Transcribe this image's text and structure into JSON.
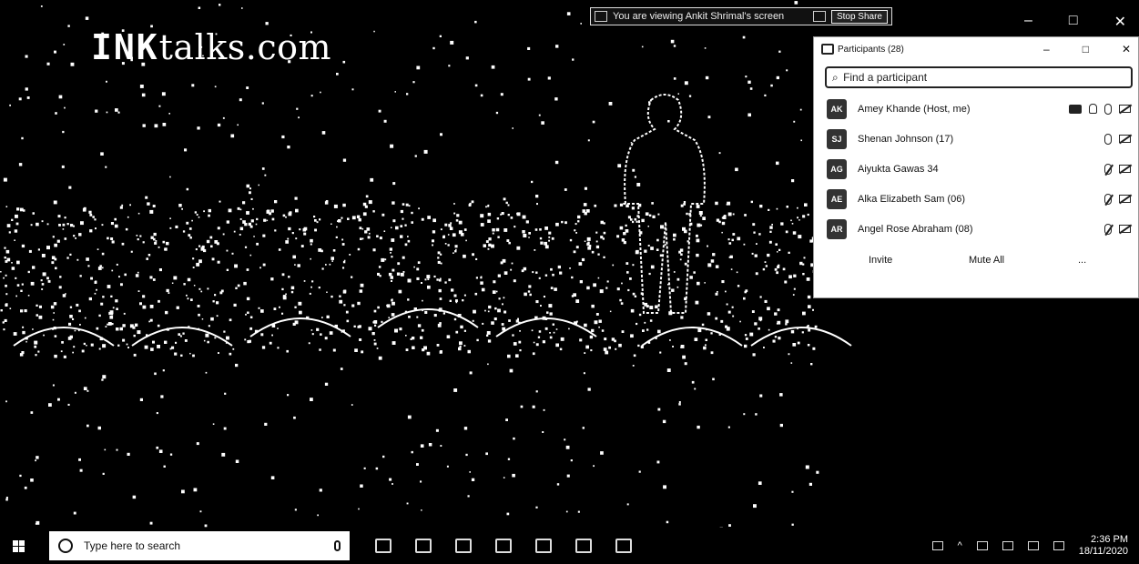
{
  "brand": {
    "prefix": "INK",
    "suffix": "talks.com"
  },
  "share_bar": {
    "meeting_id": "You are viewing Ankit Shrimal's screen",
    "stop_label": "Stop Share"
  },
  "window_controls": {
    "minimize": "–",
    "maximize": "□",
    "close": "✕"
  },
  "participants_panel": {
    "title": "Participants (28)",
    "controls": {
      "minimize": "–",
      "maximize": "□",
      "close": "✕"
    },
    "search": {
      "placeholder": "Find a participant"
    },
    "participants": [
      {
        "initials": "AK",
        "name": "Amey Khande (Host, me)"
      },
      {
        "initials": "SJ",
        "name": "Shenan Johnson (17)"
      },
      {
        "initials": "AG",
        "name": "Aiyukta Gawas 34"
      },
      {
        "initials": "AE",
        "name": "Alka Elizabeth Sam (06)"
      },
      {
        "initials": "AR",
        "name": "Angel Rose Abraham (08)"
      }
    ],
    "footer": {
      "invite": "Invite",
      "mute_all": "Mute All",
      "more": "..."
    }
  },
  "taskbar": {
    "search_placeholder": "Type here to search",
    "clock": {
      "time": "2:36 PM",
      "date": "18/11/2020"
    }
  },
  "colors": {
    "panel_bg": "#ffffff",
    "background": "#000000",
    "taskbar_bg": "#000000"
  },
  "icons": [
    "windows-logo-icon",
    "search-circle-icon",
    "microphone-icon",
    "task-view-icon",
    "edge-icon",
    "file-explorer-icon",
    "store-icon",
    "mail-icon",
    "camera-icon",
    "zoom-icon",
    "network-icon",
    "chevron-up-icon",
    "battery-icon",
    "volume-icon",
    "pen-icon"
  ]
}
